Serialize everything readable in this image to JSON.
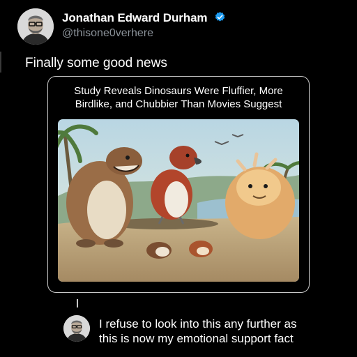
{
  "author": {
    "name": "Jonathan Edward Durham",
    "handle": "@thisone0verhere",
    "verified": true
  },
  "post": {
    "text": "Finally some good news"
  },
  "quote": {
    "headline_line1": "Study Reveals Dinosaurs Were Fluffier, More",
    "headline_line2": "Birdlike, and Chubbier Than Movies Suggest",
    "image_subject": "fluffy-dinosaurs-illustration"
  },
  "reply": {
    "line1": "I refuse to look into this any further as",
    "line2": "this is now my emotional support fact"
  },
  "colors": {
    "background": "#000000",
    "text": "#ffffff",
    "handle": "#8b9299",
    "verified": "#1d9bf0",
    "card_border": "#c8c8c8"
  }
}
